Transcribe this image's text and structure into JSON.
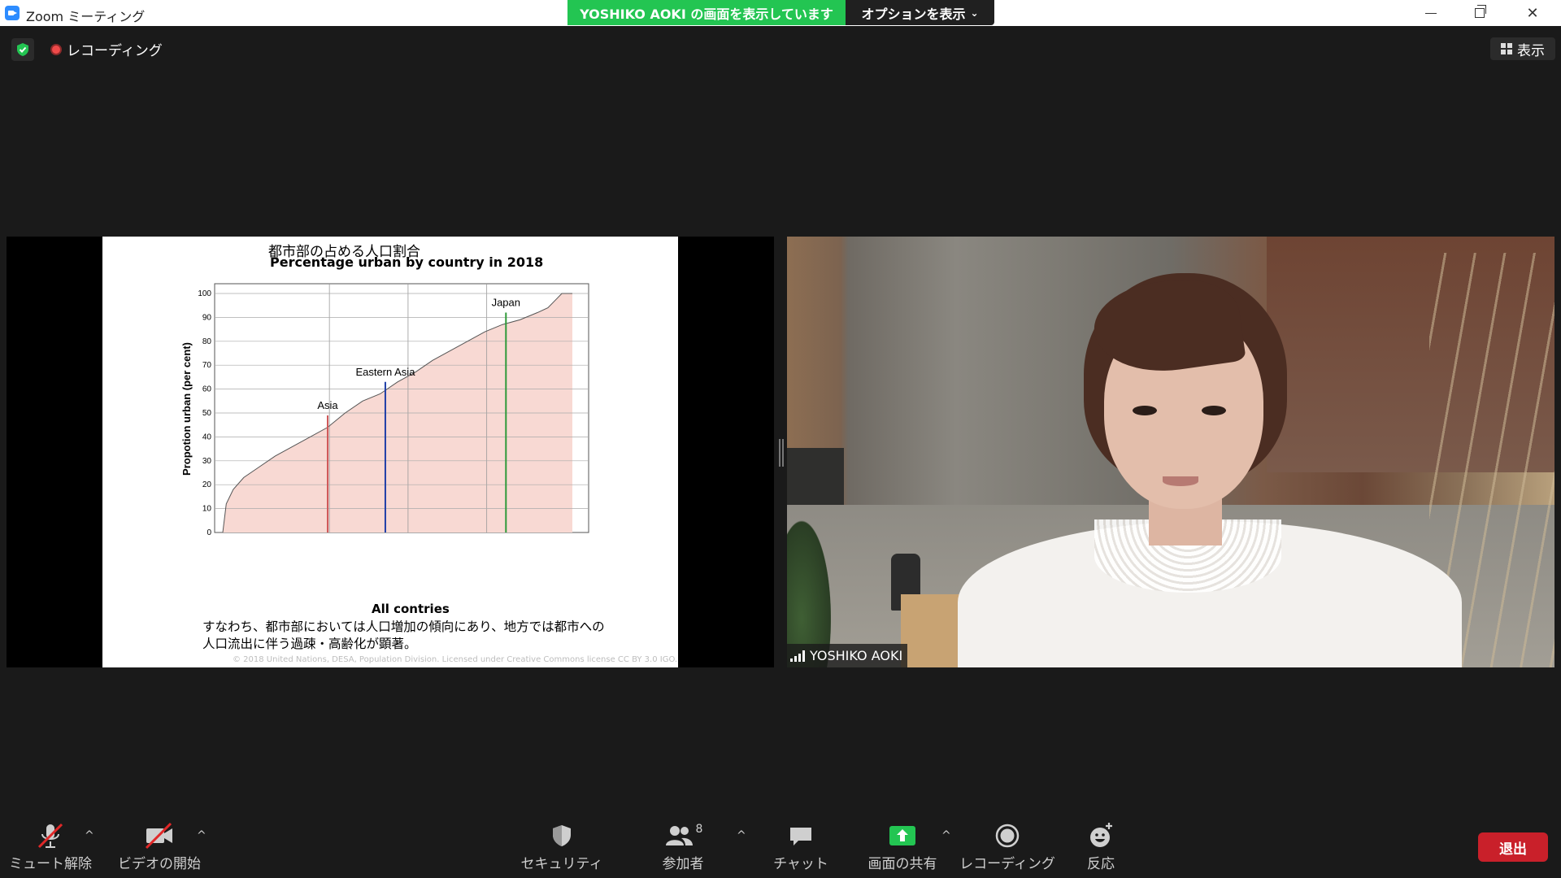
{
  "window": {
    "title": "Zoom ミーティング",
    "share_banner": "YOSHIKO AOKI の画面を表示しています",
    "options_label": "オプションを表示"
  },
  "meeting": {
    "recording_label": "レコーディング",
    "view_label": "表示"
  },
  "slide": {
    "title_jp": "都市部の占める人口割合",
    "title_en": "Percentage urban by country in 2018",
    "caption_line1": "すなわち、都市部においては人口増加の傾向にあり、地方では都市への",
    "caption_line2": "人口流出に伴う過疎・高齢化が顕著。",
    "credit": "© 2018 United Nations, DESA, Population Division. Licensed under Creative Commons license CC BY 3.0 IGO."
  },
  "chart_data": {
    "type": "area",
    "title": "Percentage urban by country in 2018",
    "xlabel": "All contries",
    "ylabel": "Propotion urban (per cent)",
    "ylim": [
      0,
      100
    ],
    "yticks": [
      "0",
      "10",
      "20",
      "30",
      "40",
      "50",
      "60",
      "70",
      "80",
      "90",
      "100"
    ],
    "xlim": [
      0,
      1
    ],
    "grid": true,
    "series": [
      {
        "x": [
          0.0,
          0.01,
          0.03,
          0.06,
          0.1,
          0.15,
          0.2,
          0.25,
          0.3,
          0.35,
          0.4,
          0.45,
          0.5,
          0.55,
          0.6,
          0.65,
          0.7,
          0.75,
          0.8,
          0.85,
          0.9,
          0.93,
          0.95,
          0.97,
          1.0
        ],
        "y": [
          0,
          12,
          18,
          23,
          27,
          32,
          36,
          40,
          44,
          50,
          55,
          58,
          63,
          67,
          72,
          76,
          80,
          84,
          87,
          89,
          92,
          94,
          97,
          100,
          100
        ]
      }
    ],
    "markers": [
      {
        "label": "Asia",
        "x": 0.3,
        "y": 49,
        "color": "#d0595a"
      },
      {
        "label": "Eastern Asia",
        "x": 0.465,
        "y": 63,
        "color": "#1f3fa8"
      },
      {
        "label": "Japan",
        "x": 0.81,
        "y": 92,
        "color": "#2f9a3a"
      }
    ],
    "fill_color": "#f8d9d3",
    "line_color": "#555555"
  },
  "video": {
    "participant_name": "YOSHIKO AOKI"
  },
  "toolbar": {
    "unmute": "ミュート解除",
    "start_video": "ビデオの開始",
    "security": "セキュリティ",
    "participants": "参加者",
    "participant_count": "8",
    "chat": "チャット",
    "share_screen": "画面の共有",
    "recording": "レコーディング",
    "reactions": "反応",
    "leave": "退出"
  },
  "colors": {
    "share_green": "#23c552",
    "leave_red": "#c9202a",
    "background": "#1a1a1a"
  }
}
